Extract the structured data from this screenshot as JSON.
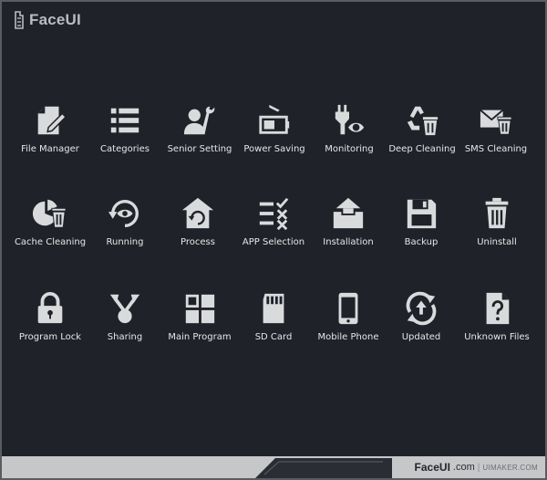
{
  "app": {
    "logo_text": "FaceUI"
  },
  "icons": [
    {
      "label": "File Manager",
      "icon": "file-edit-icon"
    },
    {
      "label": "Categories",
      "icon": "list-icon"
    },
    {
      "label": "Senior Setting",
      "icon": "user-wrench-icon"
    },
    {
      "label": "Power Saving",
      "icon": "battery-icon"
    },
    {
      "label": "Monitoring",
      "icon": "plug-eye-icon"
    },
    {
      "label": "Deep Cleaning",
      "icon": "recycle-trash-icon"
    },
    {
      "label": "SMS Cleaning",
      "icon": "mail-trash-icon"
    },
    {
      "label": "Cache Cleaning",
      "icon": "pie-trash-icon"
    },
    {
      "label": "Running",
      "icon": "refresh-eye-icon"
    },
    {
      "label": "Process",
      "icon": "home-refresh-icon"
    },
    {
      "label": "APP Selection",
      "icon": "checklist-icon"
    },
    {
      "label": "Installation",
      "icon": "box-icon"
    },
    {
      "label": "Backup",
      "icon": "floppy-icon"
    },
    {
      "label": "Uninstall",
      "icon": "trash-icon"
    },
    {
      "label": "Program Lock",
      "icon": "lock-icon"
    },
    {
      "label": "Sharing",
      "icon": "share-icon"
    },
    {
      "label": "Main Program",
      "icon": "grid-icon"
    },
    {
      "label": "SD Card",
      "icon": "sd-card-icon"
    },
    {
      "label": "Mobile Phone",
      "icon": "phone-icon"
    },
    {
      "label": "Updated",
      "icon": "update-icon"
    },
    {
      "label": "Unknown Files",
      "icon": "unknown-file-icon"
    }
  ],
  "footer": {
    "brand": "FaceUI",
    "suffix": ".com",
    "site": "UIMAKER.COM"
  },
  "colors": {
    "background": "#1f2228",
    "icon": "#d9dadc",
    "text": "#e6e7e9",
    "footer": "#c6c7c9"
  }
}
